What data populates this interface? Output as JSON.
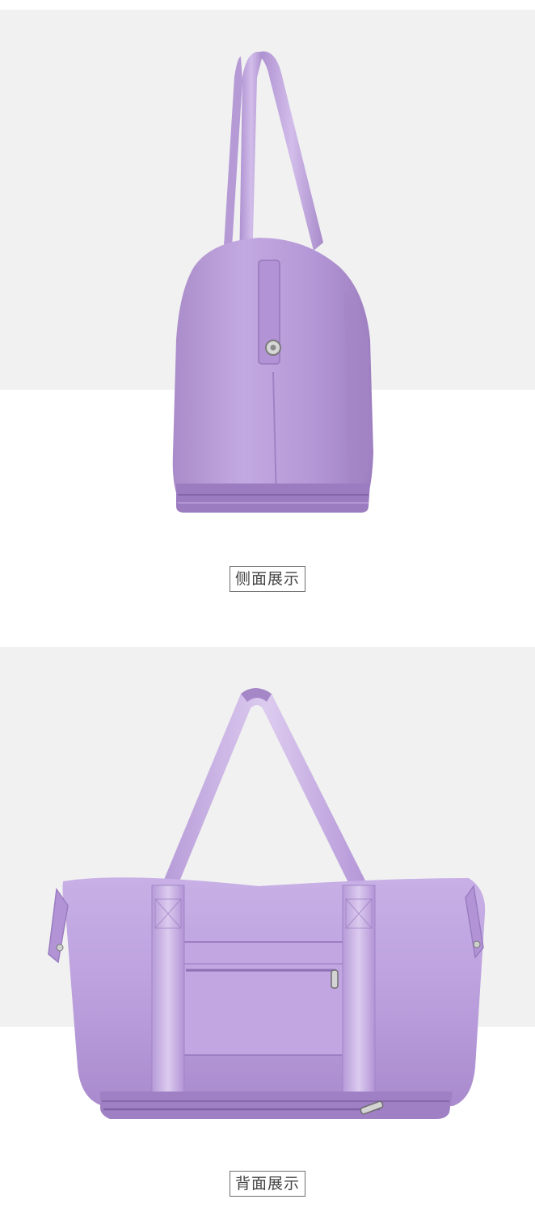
{
  "colors": {
    "backdrop": "#f1f1f1",
    "page": "#ffffff",
    "bag_main": "#b89ad8",
    "bag_light": "#c9b1e4",
    "bag_dark": "#9c7bc2",
    "strap": "#c2a6e0",
    "caption_border": "#6d6d6d",
    "caption_text": "#444444"
  },
  "side_view": {
    "caption": "侧面展示",
    "image_alt": "purple-duffel-bag-side-view"
  },
  "back_view": {
    "caption": "背面展示",
    "image_alt": "purple-duffel-bag-back-view"
  }
}
